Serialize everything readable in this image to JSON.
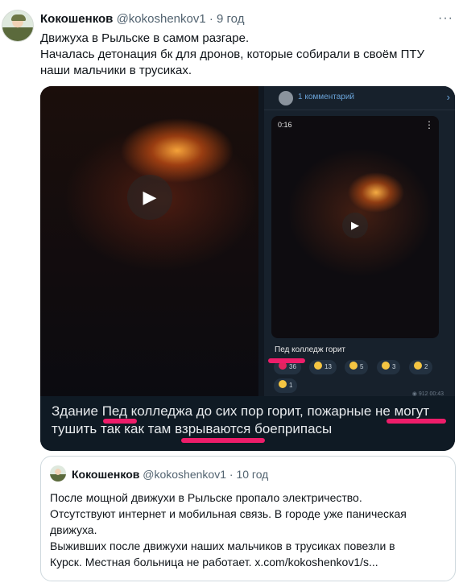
{
  "tweet": {
    "author_name": "Кокошенков",
    "author_handle": "@kokoshenkov1",
    "separator": "·",
    "time": "9 год",
    "more": "···",
    "lines": [
      "Движуха в Рыльске в самом разгаре.",
      "Началась детонация бк для дронов, которые собирали в своём ПТУ",
      "наши мальчики в трусиках."
    ]
  },
  "media": {
    "right_pane": {
      "comments_label": "1 комментарий",
      "chevron": "›",
      "timecode": "0:16",
      "kebab": "⋮",
      "caption": "Пед колледж горит",
      "reactions": [
        {
          "emoji": "heart",
          "color": "#e0245e",
          "count": "36"
        },
        {
          "emoji": "sad",
          "color": "#f5c542",
          "count": "13"
        },
        {
          "emoji": "thumbs-down",
          "color": "#f5c542",
          "count": "5"
        },
        {
          "emoji": "cry",
          "color": "#f5c542",
          "count": "3"
        },
        {
          "emoji": "clap",
          "color": "#f5c542",
          "count": "2"
        }
      ],
      "reaction_extra": {
        "emoji": "thumbs-up",
        "color": "#f5c542",
        "count": "1"
      },
      "meta": "◉ 912  00:43"
    },
    "play_icon": "▶",
    "subtitle_lines": [
      "Здание Пед колледжа до сих пор горит, пожарные не могут",
      "тушить так как там взрываются боеприпасы"
    ]
  },
  "quote": {
    "author_name": "Кокошенков",
    "author_handle": "@kokoshenkov1",
    "separator": "·",
    "time": "10 год",
    "lines": [
      "После мощной движухи в Рыльске пропало электричество.",
      "Отсутствуют интернет и мобильная связь. В городе уже паническая",
      "движуха.",
      "Выживших после движухи наших мальчиков в трусиках повезли в",
      "Курск. Местная больница не работает. x.com/kokoshenkov1/s..."
    ]
  }
}
